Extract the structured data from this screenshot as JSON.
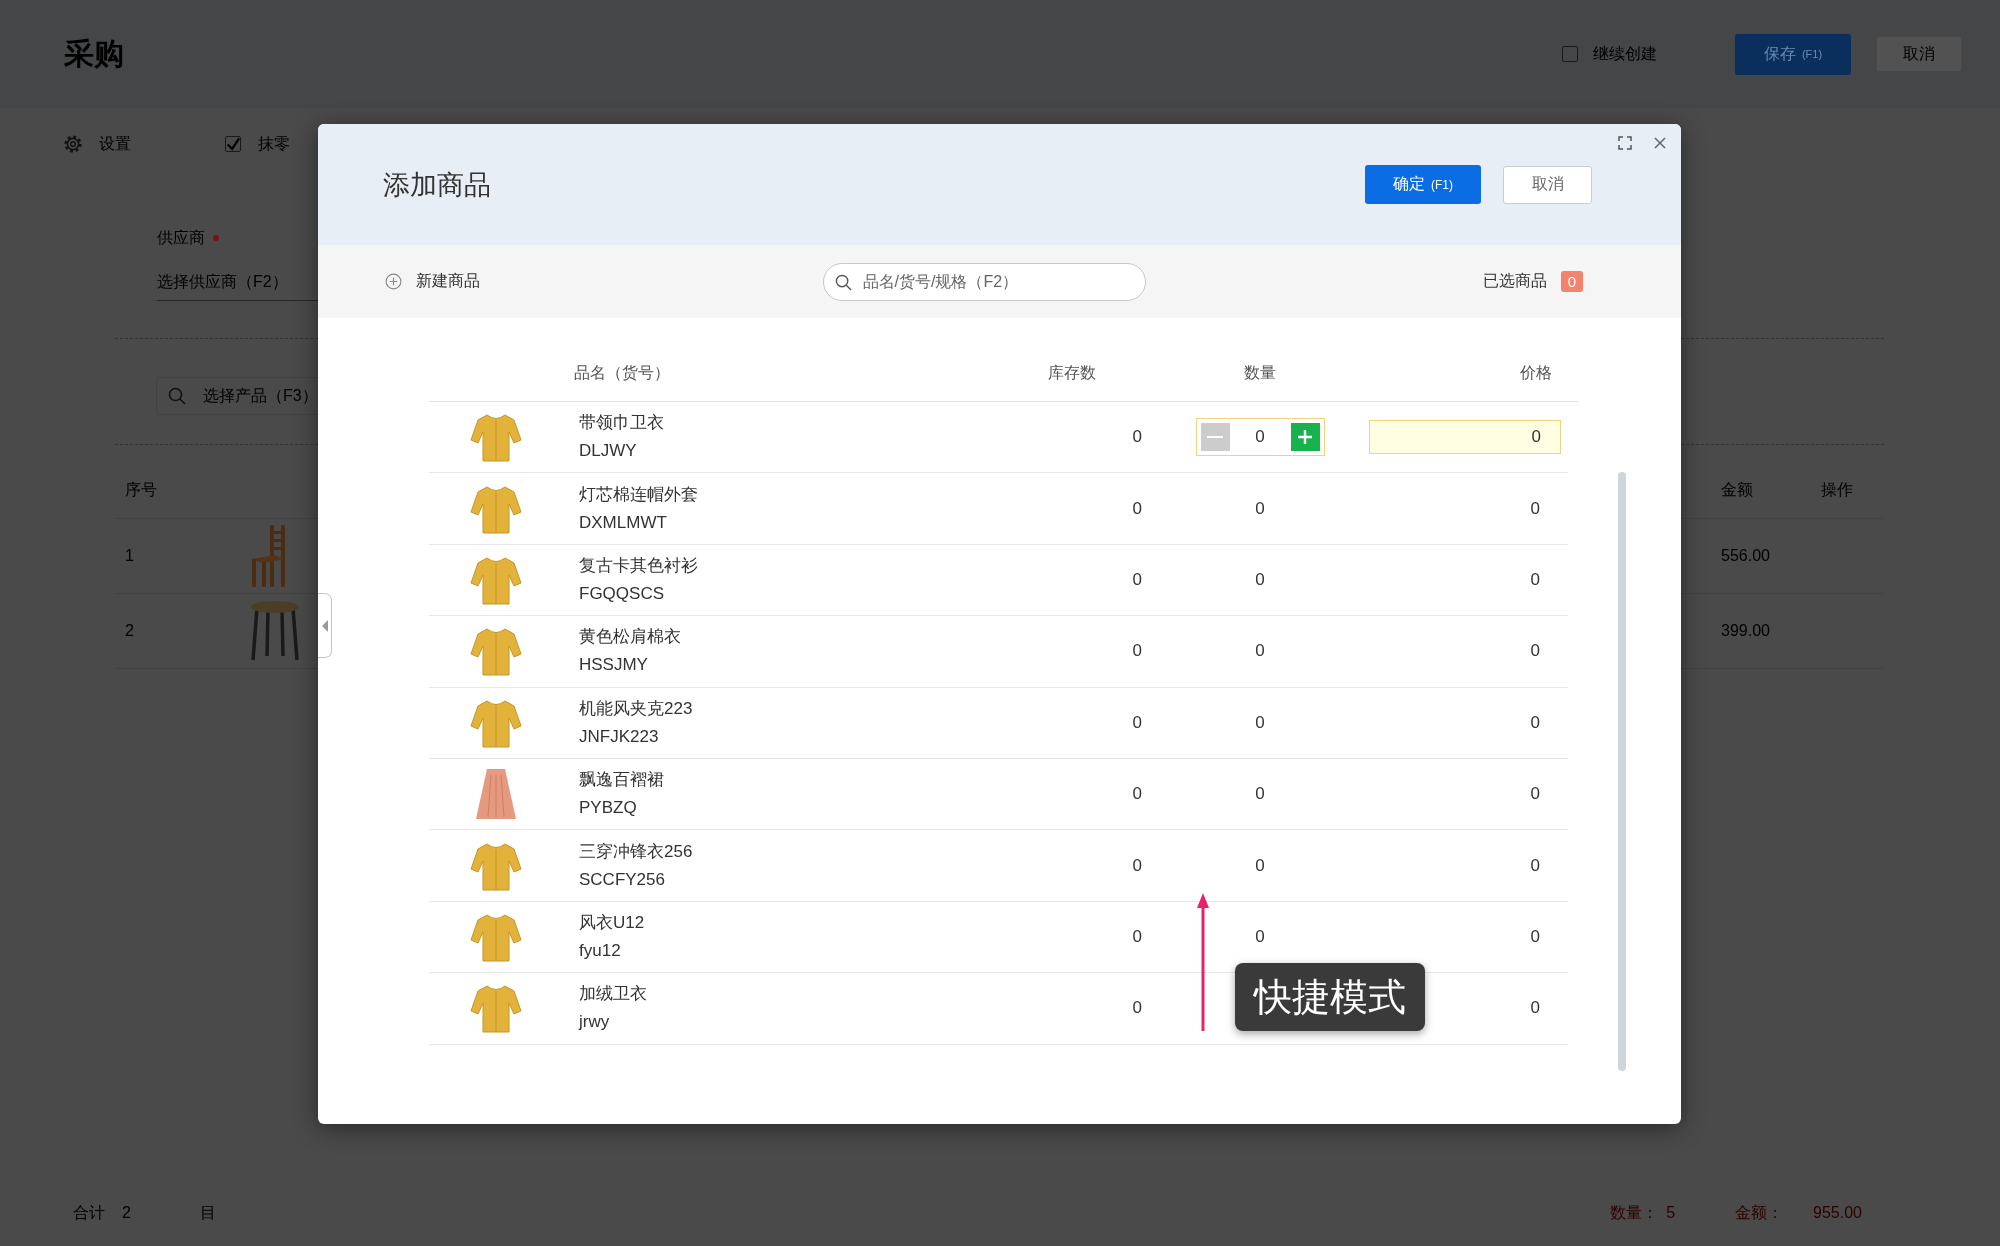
{
  "page": {
    "title": "采购",
    "continue_create": {
      "label": "继续创建",
      "checked": false
    },
    "save_button": {
      "label": "保存",
      "shortcut": "(F1)"
    },
    "cancel_button": "取消",
    "toolbar": [
      {
        "kind": "settings",
        "label": "设置"
      },
      {
        "kind": "checkbox",
        "label": "抹零",
        "checked": true
      }
    ],
    "supplier": {
      "label": "供应商",
      "required": true,
      "placeholder": "选择供应商（F2）"
    },
    "product_search": {
      "placeholder": "选择产品（F3）"
    },
    "table": {
      "columns": [
        "序号",
        "金额",
        "操作"
      ],
      "rows": [
        {
          "index": "1",
          "kind": "chair",
          "amount": "556.00"
        },
        {
          "index": "2",
          "kind": "stool",
          "amount": "399.00"
        }
      ]
    },
    "footer": {
      "total_label": "合计",
      "total_count": "2",
      "item_3": "目",
      "quantity_label": "数量：",
      "quantity": "5",
      "amount_label": "金额：",
      "amount": "955.00"
    }
  },
  "dialog": {
    "title": "添加商品",
    "confirm_button": {
      "label": "确定",
      "shortcut": "(F1)"
    },
    "cancel_button": "取消",
    "new_product_button": "新建商品",
    "search": {
      "placeholder": "品名/货号/规格（F2）"
    },
    "selected": {
      "label": "已选商品",
      "count": "0"
    },
    "columns": [
      "品名（货号）",
      "库存数",
      "数量",
      "价格"
    ],
    "rows": [
      {
        "kind": "top",
        "name": "带领巾卫衣",
        "code": "DLJWY",
        "stock": "0",
        "quantity": "0",
        "price": "0",
        "editing": true
      },
      {
        "kind": "top",
        "name": "灯芯棉连帽外套",
        "code": "DXMLMWT",
        "stock": "0",
        "quantity": "0",
        "price": "0",
        "editing": false
      },
      {
        "kind": "top",
        "name": "复古卡其色衬衫",
        "code": "FGQQSCS",
        "stock": "0",
        "quantity": "0",
        "price": "0",
        "editing": false
      },
      {
        "kind": "top",
        "name": "黄色松肩棉衣",
        "code": "HSSJMY",
        "stock": "0",
        "quantity": "0",
        "price": "0",
        "editing": false
      },
      {
        "kind": "top",
        "name": "机能风夹克223",
        "code": "JNFJK223",
        "stock": "0",
        "quantity": "0",
        "price": "0",
        "editing": false
      },
      {
        "kind": "skirt",
        "name": "飘逸百褶裙",
        "code": "PYBZQ",
        "stock": "0",
        "quantity": "0",
        "price": "0",
        "editing": false
      },
      {
        "kind": "top",
        "name": "三穿冲锋衣256",
        "code": "SCCFY256",
        "stock": "0",
        "quantity": "0",
        "price": "0",
        "editing": false
      },
      {
        "kind": "top",
        "name": "风衣U12",
        "code": "fyu12",
        "stock": "0",
        "quantity": "0",
        "price": "0",
        "editing": false
      },
      {
        "kind": "top",
        "name": "加绒卫衣",
        "code": "jrwy",
        "stock": "0",
        "price": "0",
        "editing": false
      }
    ],
    "tooltip": "快捷模式"
  }
}
